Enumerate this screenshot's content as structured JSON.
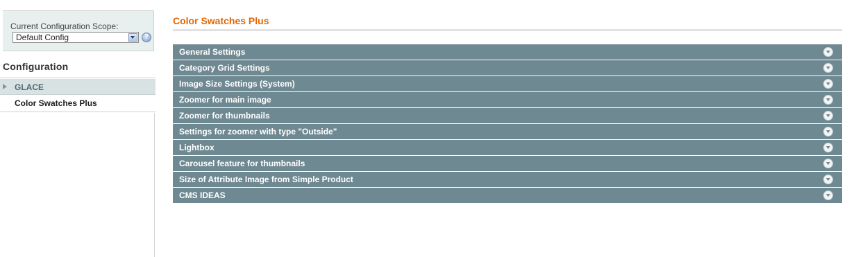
{
  "sidebar": {
    "scope_label": "Current Configuration Scope:",
    "scope_value": "Default Config",
    "help_icon": "help-icon",
    "config_title": "Configuration",
    "group_label": "GLACE",
    "nav_item": "Color Swatches Plus"
  },
  "main": {
    "title": "Color Swatches Plus",
    "sections": [
      "General Settings",
      "Category Grid Settings",
      "Image Size Settings (System)",
      "Zoomer for main image",
      "Zoomer for thumbnails",
      "Settings for zoomer with type \"Outside\"",
      "Lightbox",
      "Carousel feature for thumbnails",
      "Size of Attribute Image from Simple Product",
      "CMS IDEAS"
    ]
  },
  "colors": {
    "title_orange": "#e26703",
    "section_bg": "#6f8992",
    "group_bg": "#d8e2e3",
    "scope_bg": "#e7efef"
  }
}
